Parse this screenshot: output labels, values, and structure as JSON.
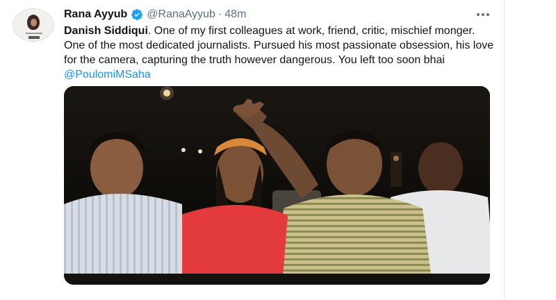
{
  "tweet": {
    "author_name": "Rana Ayyub",
    "handle": "@RanaAyyub",
    "separator": "·",
    "time": "48m",
    "text_bold": "Danish Siddiqui",
    "text_body": ". One of my first colleagues at work, friend, critic, mischief monger. One of the most dedicated journalists. Pursued his most passionate obsession, his love for the camera, capturing the truth however dangerous. You left too soon bhai ",
    "mention": "@PoulomiMSaha"
  },
  "icons": {
    "verified": "verified-badge-icon",
    "more": "more-options-icon",
    "avatar": "profile-avatar"
  },
  "colors": {
    "accent": "#1b95e0",
    "verified": "#1da1f2",
    "secondary_text": "#5b7083",
    "primary_text": "#0f1419"
  }
}
